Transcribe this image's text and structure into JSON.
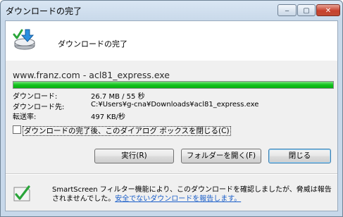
{
  "window": {
    "title": "ダウンロードの完了",
    "minimize_glyph": "‒",
    "maximize_glyph": "▢",
    "close_glyph": "✕"
  },
  "header": {
    "text": "ダウンロードの完了",
    "icon": "download-complete-icon"
  },
  "download": {
    "source": "www.franz.com - acl81_express.exe",
    "progress": 1.0,
    "rows": [
      {
        "label": "ダウンロード:",
        "value": "26.7 MB / 55 秒"
      },
      {
        "label": "ダウンロード先:",
        "value": "C:¥Users¥g-cna¥Downloads¥acl81_express.exe"
      },
      {
        "label": "転送率:",
        "value": "497 KB/秒"
      }
    ]
  },
  "checkbox": {
    "label": "ダウンロードの完了後、このダイアログ ボックスを閉じる(C)",
    "checked": false
  },
  "buttons": {
    "run": "実行(R)",
    "open_folder": "フォルダーを開く(F)",
    "close": "閉じる"
  },
  "smartscreen": {
    "text": "SmartScreen フィルター機能により、このダウンロードを確認しましたが、脅威は報告されませんでした。",
    "link": "安全でないダウンロードを報告します。",
    "icon": "shield-check-icon"
  },
  "colors": {
    "progress": "#13c31c",
    "link": "#1a5ec9",
    "close_button": "#c7412d"
  }
}
